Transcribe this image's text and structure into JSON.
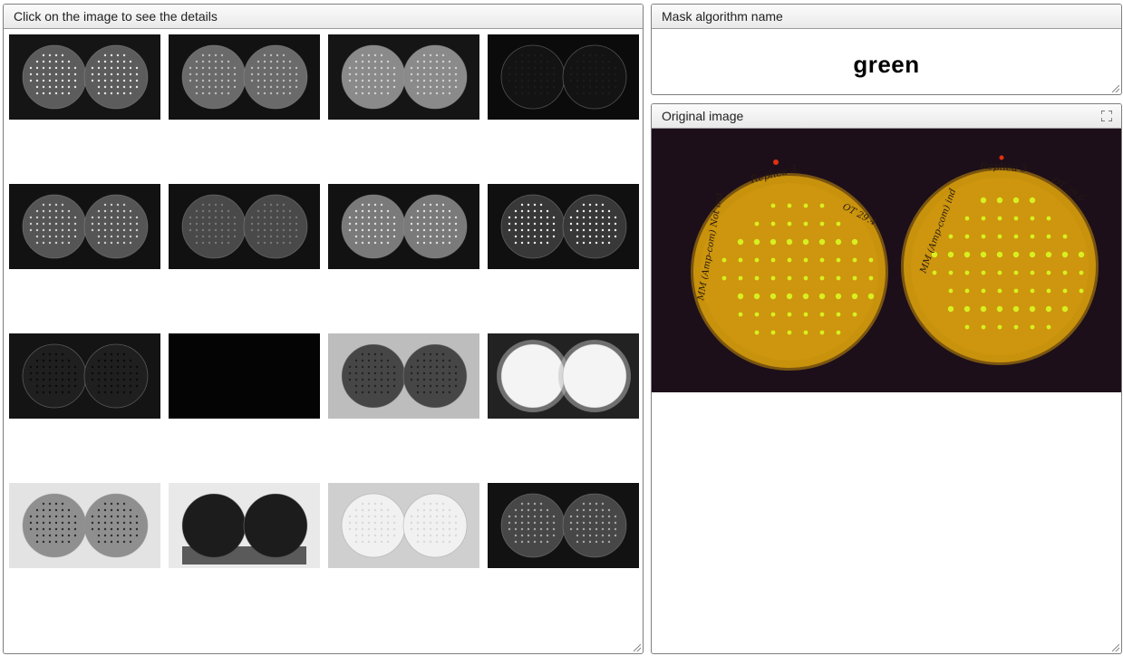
{
  "gallery_panel": {
    "title": "Click on the image to see the details"
  },
  "mask_panel": {
    "title": "Mask algorithm name",
    "value": "green"
  },
  "original_panel": {
    "title": "Original image",
    "expand_icon": "expand-icon"
  },
  "thumbnails": [
    {
      "style": "dots",
      "bg": "#151515",
      "plate": "#5c5c5c",
      "dot": "#e6e6e6"
    },
    {
      "style": "dots",
      "bg": "#121212",
      "plate": "#6a6a6a",
      "dot": "#bdbdbd"
    },
    {
      "style": "dots",
      "bg": "#151515",
      "plate": "#8a8a8a",
      "dot": "#d2d2d2"
    },
    {
      "style": "dots",
      "bg": "#0b0b0b",
      "plate": "#131313",
      "dot": "#1d1d1d"
    },
    {
      "style": "dots",
      "bg": "#121212",
      "plate": "#555555",
      "dot": "#cfcfcf"
    },
    {
      "style": "dots",
      "bg": "#111111",
      "plate": "#494949",
      "dot": "#777777"
    },
    {
      "style": "dots",
      "bg": "#121212",
      "plate": "#7a7a7a",
      "dot": "#e0e0e0"
    },
    {
      "style": "dots",
      "bg": "#101010",
      "plate": "#383838",
      "dot": "#f2f2f2"
    },
    {
      "style": "dots",
      "bg": "#141414",
      "plate": "#1f1f1f",
      "dot": "#0a0a0a"
    },
    {
      "style": "blank",
      "bg": "#040404",
      "plate": "#050505",
      "dot": "#050505"
    },
    {
      "style": "dots",
      "bg": "#bdbdbd",
      "plate": "#464646",
      "dot": "#222222"
    },
    {
      "style": "glow",
      "bg": "#222222",
      "plate": "#f4f4f4",
      "dot": "#e6e6e6"
    },
    {
      "style": "dots",
      "bg": "#e3e3e3",
      "plate": "#8f8f8f",
      "dot": "#2c2c2c"
    },
    {
      "style": "blob",
      "bg": "#e9e9e9",
      "plate": "#1c1c1c",
      "dot": "#1c1c1c"
    },
    {
      "style": "dots",
      "bg": "#cfcfcf",
      "plate": "#f1f1f1",
      "dot": "#d8d8d8"
    },
    {
      "style": "dots",
      "bg": "#121212",
      "plate": "#474747",
      "dot": "#a8a8a8"
    }
  ],
  "colors": {
    "orig_bg": "#1c0f1a",
    "agar": "#c8920c",
    "colony": "#d8f020",
    "ink": "#2a1a10"
  },
  "plate_labels": {
    "left_top": "Replica 3",
    "left_date": "OT 29.4",
    "left_side": "MM (Amp-com) Not ind",
    "right_top": "Replica 3",
    "right_date": "OT 29.6",
    "right_side": "MM (Amp-com) ind"
  }
}
